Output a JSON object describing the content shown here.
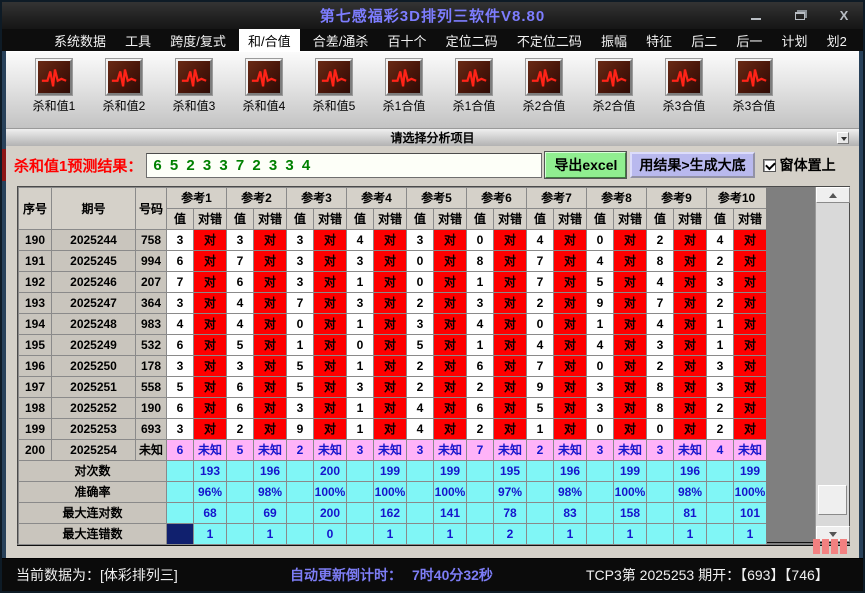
{
  "window": {
    "title": "第七感福彩3D排列三软件V8.80"
  },
  "menu": {
    "items": [
      {
        "label": "系统数据",
        "active": false
      },
      {
        "label": "工具",
        "active": false
      },
      {
        "label": "跨度/复式",
        "active": false
      },
      {
        "label": "和/合值",
        "active": true
      },
      {
        "label": "合差/通杀",
        "active": false
      },
      {
        "label": "百十个",
        "active": false
      },
      {
        "label": "定位二码",
        "active": false
      },
      {
        "label": "不定位二码",
        "active": false
      },
      {
        "label": "振幅",
        "active": false
      },
      {
        "label": "特征",
        "active": false
      },
      {
        "label": "后二",
        "active": false
      },
      {
        "label": "后一",
        "active": false
      },
      {
        "label": "计划",
        "active": false
      },
      {
        "label": "划2",
        "active": false
      }
    ]
  },
  "toolbar": {
    "buttons": [
      {
        "label": "杀和值1",
        "icon": "ecg-icon"
      },
      {
        "label": "杀和值2",
        "icon": "ecg-icon"
      },
      {
        "label": "杀和值3",
        "icon": "ecg-icon"
      },
      {
        "label": "杀和值4",
        "icon": "ecg-icon"
      },
      {
        "label": "杀和值5",
        "icon": "ecg-icon"
      },
      {
        "label": "杀1合值",
        "icon": "ecg-icon"
      },
      {
        "label": "杀1合值",
        "icon": "ecg-icon"
      },
      {
        "label": "杀2合值",
        "icon": "ecg-icon"
      },
      {
        "label": "杀2合值",
        "icon": "ecg-icon"
      },
      {
        "label": "杀3合值",
        "icon": "ecg-icon"
      },
      {
        "label": "杀3合值",
        "icon": "ecg-icon"
      }
    ],
    "hint": "请选择分析项目"
  },
  "prediction": {
    "label": "杀和值1预测结果：",
    "value": "6 5 2 3 3 7 2 3 3 4",
    "export_button": "导出excel",
    "generate_button": "用结果>生成大底",
    "topmost_label": "窗体置上",
    "topmost_checked": true
  },
  "table": {
    "headers": {
      "seq": "序号",
      "period": "期号",
      "number": "号码",
      "value": "值",
      "result": "对错",
      "ref_prefix": "参考"
    },
    "ref_count": 10,
    "rows": [
      {
        "seq": "190",
        "period": "2025244",
        "number": "758",
        "values": [
          "3",
          "3",
          "3",
          "4",
          "3",
          "0",
          "4",
          "0",
          "2",
          "4"
        ],
        "status": "对",
        "unknown": false
      },
      {
        "seq": "191",
        "period": "2025245",
        "number": "994",
        "values": [
          "6",
          "7",
          "3",
          "3",
          "0",
          "8",
          "7",
          "4",
          "8",
          "2"
        ],
        "status": "对",
        "unknown": false
      },
      {
        "seq": "192",
        "period": "2025246",
        "number": "207",
        "values": [
          "7",
          "6",
          "3",
          "1",
          "0",
          "1",
          "7",
          "5",
          "4",
          "3"
        ],
        "status": "对",
        "unknown": false
      },
      {
        "seq": "193",
        "period": "2025247",
        "number": "364",
        "values": [
          "3",
          "4",
          "7",
          "3",
          "2",
          "3",
          "2",
          "9",
          "7",
          "2"
        ],
        "status": "对",
        "unknown": false
      },
      {
        "seq": "194",
        "period": "2025248",
        "number": "983",
        "values": [
          "4",
          "4",
          "0",
          "1",
          "3",
          "4",
          "0",
          "1",
          "4",
          "1"
        ],
        "status": "对",
        "unknown": false
      },
      {
        "seq": "195",
        "period": "2025249",
        "number": "532",
        "values": [
          "6",
          "5",
          "1",
          "0",
          "5",
          "1",
          "4",
          "4",
          "3",
          "1"
        ],
        "status": "对",
        "unknown": false
      },
      {
        "seq": "196",
        "period": "2025250",
        "number": "178",
        "values": [
          "3",
          "3",
          "5",
          "1",
          "2",
          "6",
          "7",
          "0",
          "2",
          "3"
        ],
        "status": "对",
        "unknown": false
      },
      {
        "seq": "197",
        "period": "2025251",
        "number": "558",
        "values": [
          "5",
          "6",
          "5",
          "3",
          "2",
          "2",
          "9",
          "3",
          "8",
          "3"
        ],
        "status": "对",
        "unknown": false
      },
      {
        "seq": "198",
        "period": "2025252",
        "number": "190",
        "values": [
          "6",
          "6",
          "3",
          "1",
          "4",
          "6",
          "5",
          "3",
          "8",
          "2"
        ],
        "status": "对",
        "unknown": false
      },
      {
        "seq": "199",
        "period": "2025253",
        "number": "693",
        "values": [
          "3",
          "2",
          "9",
          "1",
          "4",
          "2",
          "1",
          "0",
          "0",
          "2"
        ],
        "status": "对",
        "unknown": false
      },
      {
        "seq": "200",
        "period": "2025254",
        "number": "未知",
        "values": [
          "6",
          "5",
          "2",
          "3",
          "3",
          "7",
          "2",
          "3",
          "3",
          "4"
        ],
        "status": "未知",
        "unknown": true
      }
    ],
    "summary": [
      {
        "label": "对次数",
        "values": [
          "193",
          "196",
          "200",
          "199",
          "199",
          "195",
          "196",
          "199",
          "196",
          "199"
        ],
        "selected_first_cell": false
      },
      {
        "label": "准确率",
        "values": [
          "96%",
          "98%",
          "100%",
          "100%",
          "100%",
          "97%",
          "98%",
          "100%",
          "98%",
          "100%"
        ],
        "selected_first_cell": false
      },
      {
        "label": "最大连对数",
        "values": [
          "68",
          "69",
          "200",
          "162",
          "141",
          "78",
          "83",
          "158",
          "81",
          "101"
        ],
        "selected_first_cell": false
      },
      {
        "label": "最大连错数",
        "values": [
          "1",
          "1",
          "0",
          "1",
          "1",
          "2",
          "1",
          "1",
          "1",
          "1"
        ],
        "selected_first_cell": true
      }
    ]
  },
  "statusbar": {
    "data_source": "当前数据为：[体彩排列三]",
    "countdown_label": "自动更新倒计时：",
    "countdown_value": "7时40分32秒",
    "draw_info": "TCP3第 2025253 期开：【693】【746】"
  },
  "colors": {
    "title_text": "#7d7dff",
    "predict_label": "#ff0000",
    "predict_value_text": "#008000",
    "excel_button_bg": "#90ee90",
    "dadi_button_bg": "#b9b9ee",
    "hit_cell_bg": "#ff0000",
    "unknown_cell_bg": "#ffb3f8",
    "unknown_cell_text": "#1515cc",
    "summary_cell_bg": "#80f6f6",
    "summary_cell_text": "#1515cc",
    "selected_cell_bg": "#10206e",
    "countdown_text": "#7d7df5",
    "indicator_block": "#f28080"
  }
}
